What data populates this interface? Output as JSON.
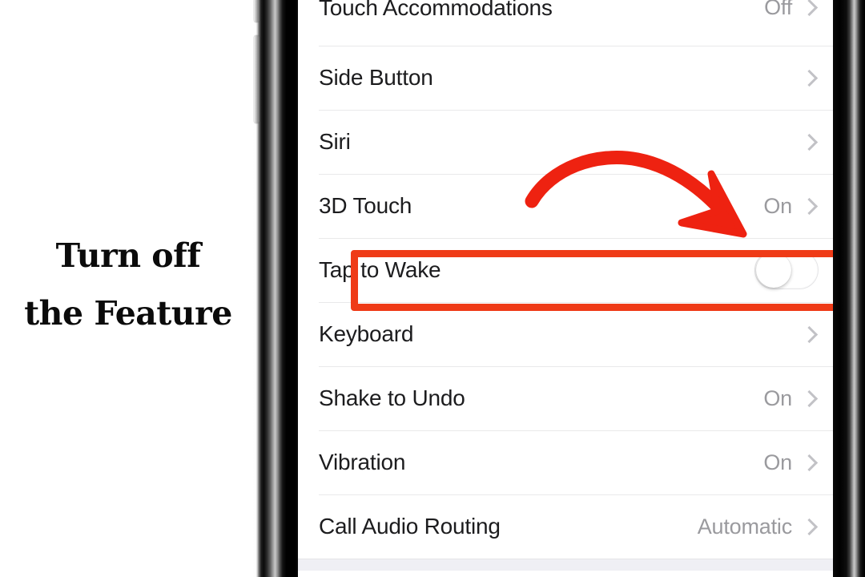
{
  "annotation": {
    "caption_line1": "Turn off",
    "caption_line2": "the Feature",
    "highlight_color": "#ef3b17",
    "arrow_color": "#ee2211",
    "arrow_target": "Tap to Wake toggle"
  },
  "device": {
    "kind": "iphone",
    "bezel_color": "#000000",
    "screen_background": "#ffffff"
  },
  "screen": {
    "app": "Settings",
    "rows": [
      {
        "label": "Touch Accommodations",
        "value": "Off",
        "accessory": "chevron",
        "clipped": true
      },
      {
        "label": "Side Button",
        "value": "",
        "accessory": "chevron"
      },
      {
        "label": "Siri",
        "value": "",
        "accessory": "chevron"
      },
      {
        "label": "3D Touch",
        "value": "On",
        "accessory": "chevron"
      },
      {
        "label": "Tap to Wake",
        "value": "",
        "accessory": "switch",
        "switch_on": false,
        "highlighted": true
      },
      {
        "label": "Keyboard",
        "value": "",
        "accessory": "chevron"
      },
      {
        "label": "Shake to Undo",
        "value": "On",
        "accessory": "chevron"
      },
      {
        "label": "Vibration",
        "value": "On",
        "accessory": "chevron"
      },
      {
        "label": "Call Audio Routing",
        "value": "Automatic",
        "accessory": "chevron"
      }
    ]
  }
}
